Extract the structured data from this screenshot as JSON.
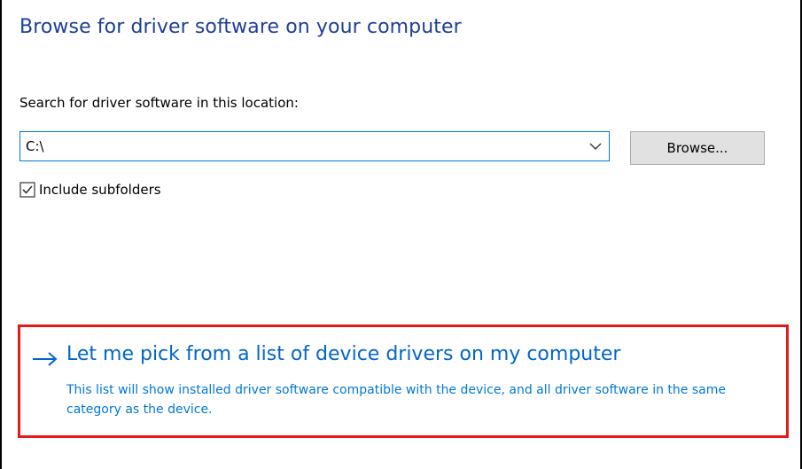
{
  "dialog": {
    "title": "Browse for driver software on your computer",
    "search_label": "Search for driver software in this location:",
    "location": {
      "value": "C:\\",
      "dropdown_icon": "chevron-down-icon"
    },
    "browse_button": "Browse...",
    "include_subfolders": {
      "label": "Include subfolders",
      "checked": true
    },
    "pick_option": {
      "icon": "arrow-right-icon",
      "title": "Let me pick from a list of device drivers on my computer",
      "description": "This list will show installed driver software compatible with the device, and all driver software in the same category as the device."
    }
  },
  "colors": {
    "title": "#1f3f96",
    "link": "#0066cc",
    "link_desc": "#0078d7",
    "focus_border": "#0078d7",
    "highlight": "#e51a1a"
  }
}
